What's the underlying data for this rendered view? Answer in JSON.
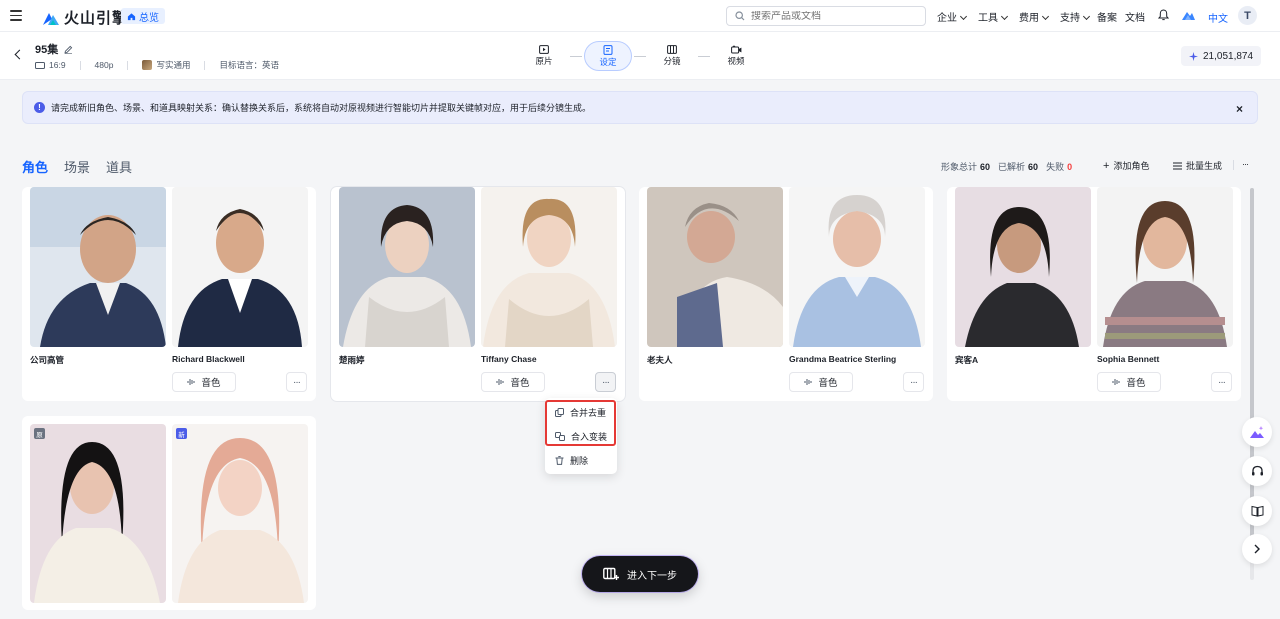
{
  "topbar": {
    "logo_text": "火山引擎",
    "home_label": "总览",
    "search_placeholder": "搜索产品或文档",
    "menu": [
      "企业",
      "工具",
      "费用",
      "支持"
    ],
    "filing": "备案",
    "docs": "文档",
    "language": "中文",
    "avatar_initial": "T"
  },
  "project": {
    "title": "95集",
    "ratio": "16:9",
    "resolution": "480p",
    "style": "写实通用",
    "target_language": "目标语言：英语",
    "credits": "21,051,874",
    "steps": [
      {
        "label": "原片",
        "icon": "film-play-icon"
      },
      {
        "label": "设定",
        "icon": "settings-doc-icon",
        "active": true
      },
      {
        "label": "分镜",
        "icon": "storyboard-icon"
      },
      {
        "label": "视频",
        "icon": "video-sparkle-icon"
      }
    ]
  },
  "notice": {
    "text": "请完成新旧角色、场景、和道具映射关系：确认替换关系后，系统将自动对原视频进行智能切片并提取关键帧对应，用于后续分镜生成。"
  },
  "tabs": [
    {
      "label": "角色",
      "active": true
    },
    {
      "label": "场景"
    },
    {
      "label": "道具"
    }
  ],
  "stats": {
    "total_label": "形象总计",
    "total": "60",
    "parsed_label": "已解析",
    "parsed": "60",
    "failed_label": "失败",
    "failed": "0"
  },
  "toolbar": {
    "add_role": "添加角色",
    "batch_generate": "批量生成"
  },
  "cards": [
    {
      "left_name": "公司高管",
      "right_name": "Richard Blackwell",
      "voice": "音色"
    },
    {
      "left_name": "楚雨婷",
      "right_name": "Tiffany Chase",
      "voice": "音色"
    },
    {
      "left_name": "老夫人",
      "right_name": "Grandma Beatrice Sterling",
      "voice": "音色"
    },
    {
      "left_name": "宾客A",
      "right_name": "Sophia Bennett",
      "voice": "音色"
    },
    {
      "left_badge": "原",
      "right_badge": "新"
    }
  ],
  "dropdown": {
    "items": [
      {
        "label": "合并去重",
        "icon": "copy-merge-icon"
      },
      {
        "label": "合入变装",
        "icon": "merge-costume-icon"
      },
      {
        "label": "删除",
        "icon": "trash-icon"
      }
    ]
  },
  "next_button": "进入下一步",
  "colors": {
    "accent": "#1664ff",
    "fail": "#f53f3f",
    "highlight": "#e53935"
  }
}
